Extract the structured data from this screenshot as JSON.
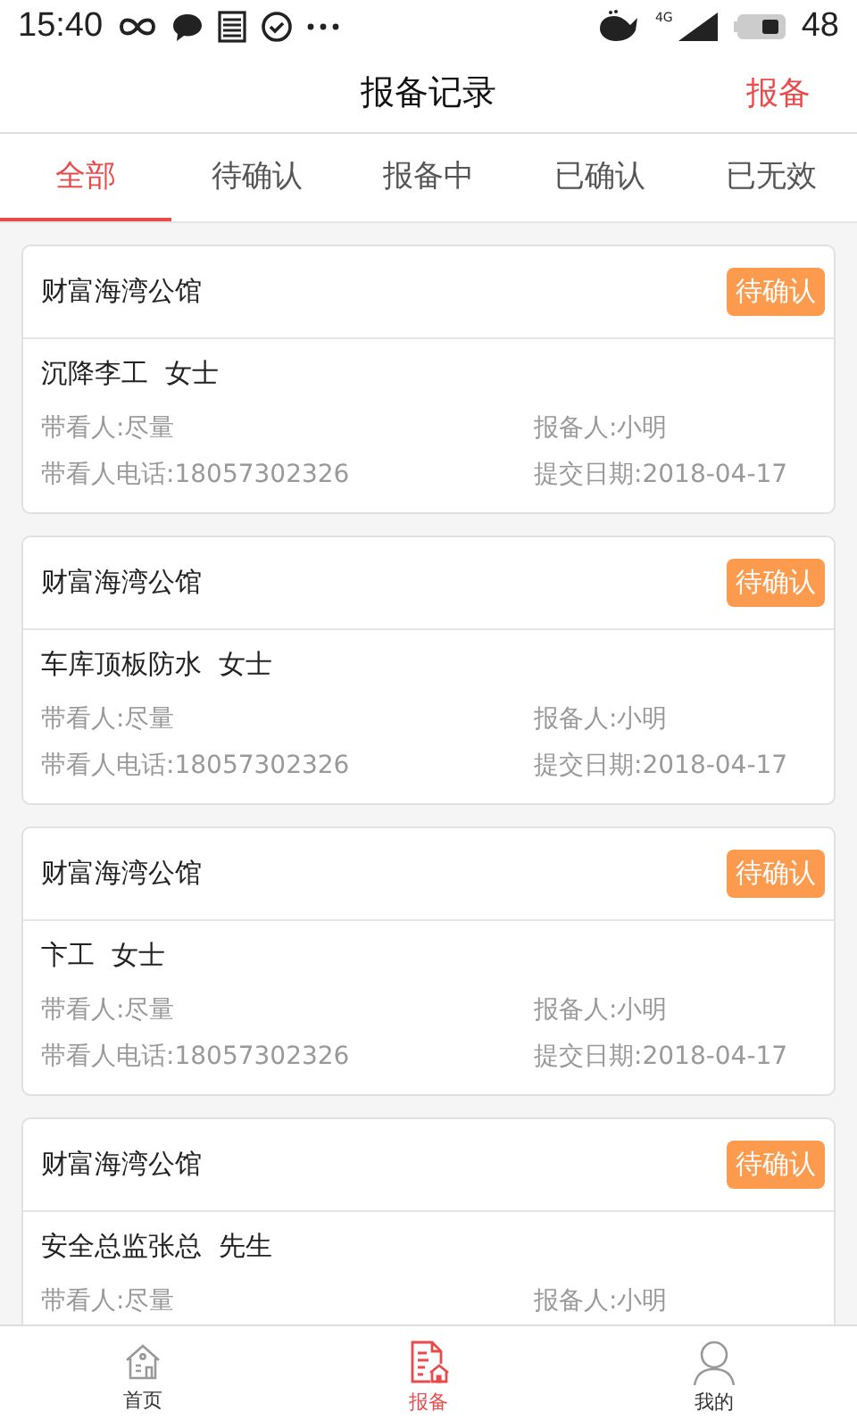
{
  "status_bar": {
    "time": "15:40",
    "network": "4G",
    "battery": "48"
  },
  "header": {
    "title": "报备记录",
    "action": "报备"
  },
  "tabs": [
    {
      "label": "全部",
      "selected": true
    },
    {
      "label": "待确认",
      "selected": false
    },
    {
      "label": "报备中",
      "selected": false
    },
    {
      "label": "已确认",
      "selected": false
    },
    {
      "label": "已无效",
      "selected": false
    }
  ],
  "records": [
    {
      "project": "财富海湾公馆",
      "status": "待确认",
      "customer": "沉降李工  女士",
      "companion": "带看人:尽量",
      "reporter": "报备人:小明",
      "phone": "带看人电话:18057302326",
      "date": "提交日期:2018-04-17"
    },
    {
      "project": "财富海湾公馆",
      "status": "待确认",
      "customer": "车库顶板防水  女士",
      "companion": "带看人:尽量",
      "reporter": "报备人:小明",
      "phone": "带看人电话:18057302326",
      "date": "提交日期:2018-04-17"
    },
    {
      "project": "财富海湾公馆",
      "status": "待确认",
      "customer": "卞工  女士",
      "companion": "带看人:尽量",
      "reporter": "报备人:小明",
      "phone": "带看人电话:18057302326",
      "date": "提交日期:2018-04-17"
    },
    {
      "project": "财富海湾公馆",
      "status": "待确认",
      "customer": "安全总监张总  先生",
      "companion": "带看人:尽量",
      "reporter": "报备人:小明"
    }
  ],
  "bottom_nav": [
    {
      "kind": "home",
      "label": "首页",
      "selected": false
    },
    {
      "kind": "report",
      "label": "报备",
      "selected": true
    },
    {
      "kind": "profile",
      "label": "我的",
      "selected": false
    }
  ]
}
